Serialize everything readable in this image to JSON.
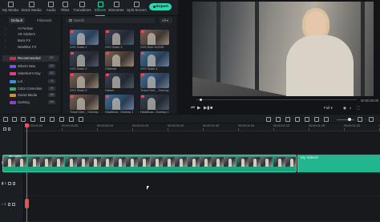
{
  "toolbar": {
    "tabs": [
      "My Media",
      "Stock Media",
      "Audio",
      "Titles",
      "Transitions",
      "Effects",
      "Elements",
      "Split Screen"
    ],
    "active_tab": "Effects",
    "export_label": "Export"
  },
  "sidebar": {
    "tabs": [
      "Default",
      "Filmstock"
    ],
    "items": [
      {
        "label": "AI Portrait",
        "count": ""
      },
      {
        "label": "AR Stickers",
        "count": ""
      },
      {
        "label": "Boris FX",
        "count": ""
      },
      {
        "label": "NewBlue FX",
        "count": ""
      },
      {
        "label": "Recommended",
        "count": "57"
      },
      {
        "label": "What's New",
        "count": "10"
      },
      {
        "label": "Valentine's Day",
        "count": "22"
      },
      {
        "label": "Lut",
        "count": "3"
      },
      {
        "label": "Color Correction",
        "count": "8"
      },
      {
        "label": "Social Media",
        "count": "18"
      },
      {
        "label": "Gaming",
        "count": "10"
      }
    ]
  },
  "effects": {
    "search_placeholder": "Search",
    "filter_label": "All",
    "items": [
      "VHS Static 1",
      "VHS Static 3",
      "VHS BAD NOISE",
      "VHS Static 2",
      "Glitterati",
      "VHS Static 4",
      "VHS Static 5",
      "Distort",
      "Travel Diet _ Overlay 1",
      "Travel Diet _ Overlay 2",
      "Healthcar...Overlay 1",
      "Healthcar...Overlay 2"
    ]
  },
  "player": {
    "time_left": "00:00:00:00",
    "time_right": "00:00:00:00",
    "quality": "Full"
  },
  "timeline": {
    "ruler_labels": [
      "00:00:00:00",
      "00:00:00:05",
      "00:00:00:10",
      "00:00:00:15",
      "00:00:00:20",
      "00:00:01:00",
      "00:00:01:05",
      "00:00:01:10",
      "00:00:01:15",
      "00:00:01:20",
      "00:00:02:00"
    ],
    "clip_label": "My Video",
    "clip2_label": "My Video3",
    "track_labels": [
      "2",
      "1",
      "1"
    ]
  },
  "colors": {
    "accent": "#2fd6b0",
    "playhead": "#ff4757"
  }
}
